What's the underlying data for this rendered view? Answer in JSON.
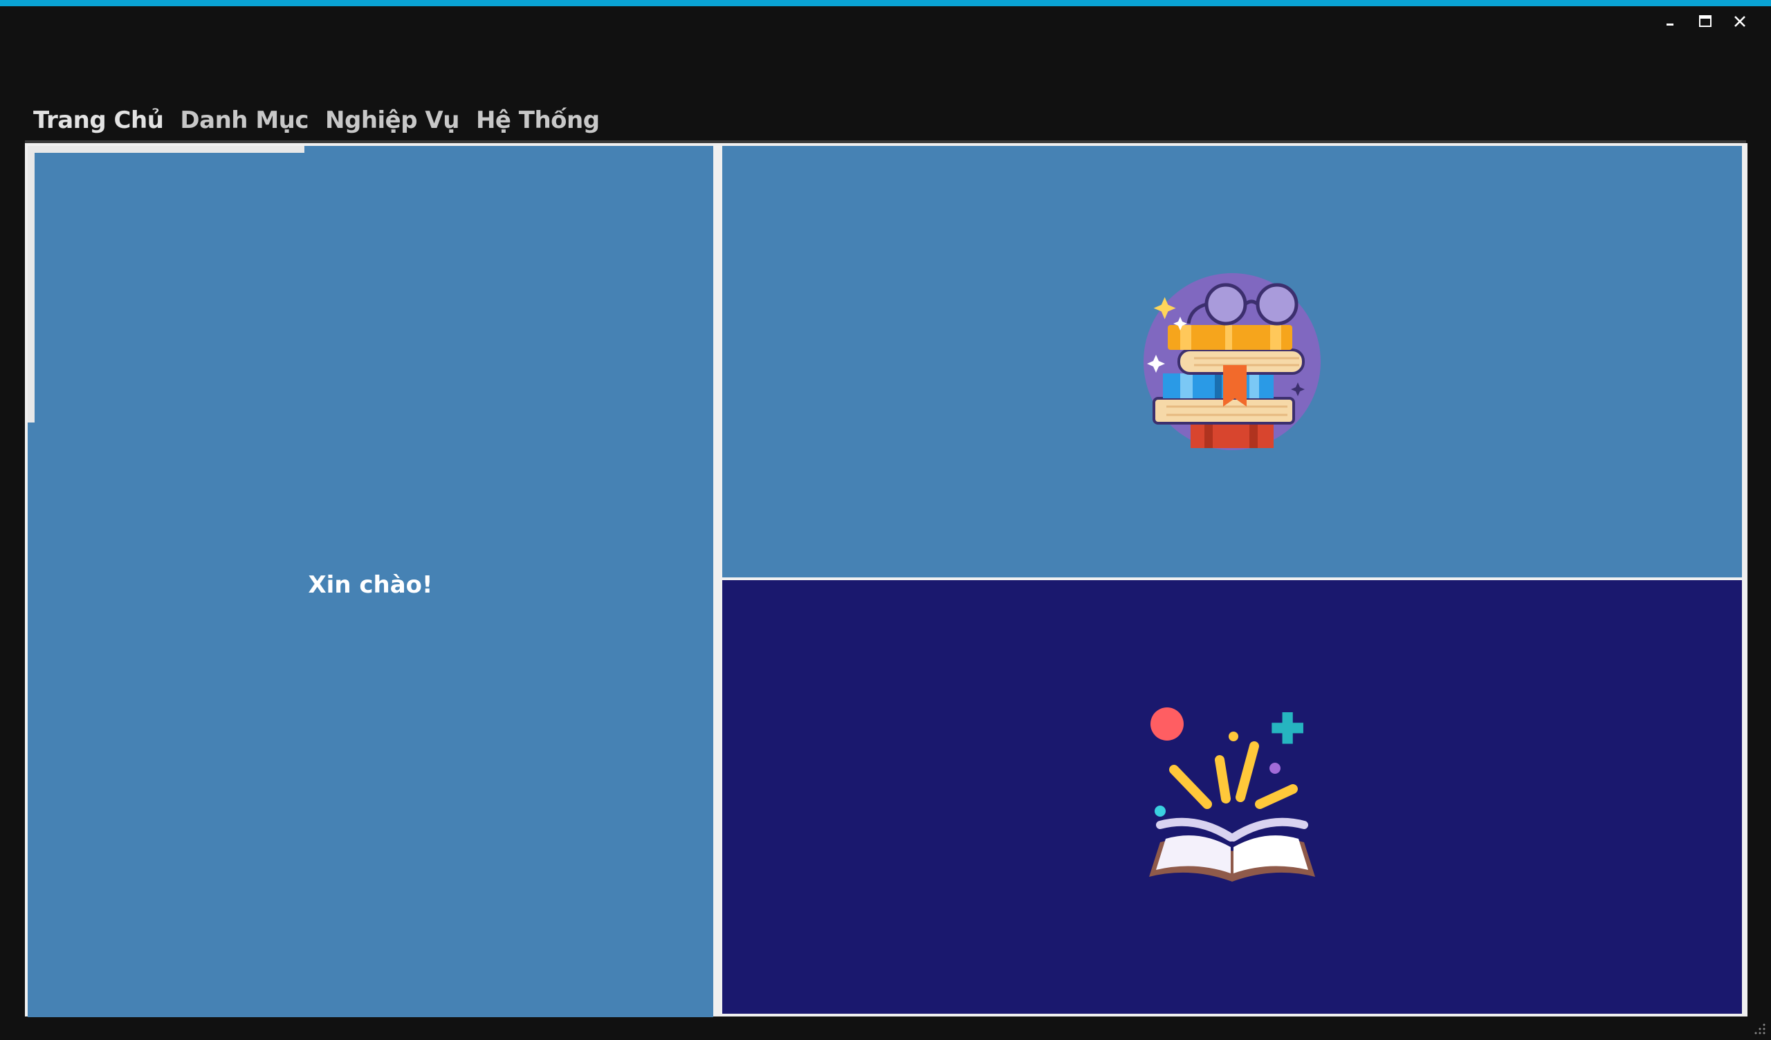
{
  "window": {
    "accent_color": "#0aa3d4",
    "controls": [
      {
        "name": "minimize",
        "icon": "minimize-icon"
      },
      {
        "name": "maximize",
        "icon": "maximize-icon"
      },
      {
        "name": "close",
        "icon": "close-icon"
      }
    ]
  },
  "tabs": [
    {
      "label": "Trang Chủ",
      "active": true
    },
    {
      "label": "Danh Mục",
      "active": false
    },
    {
      "label": "Nghiệp Vụ",
      "active": false
    },
    {
      "label": "Hệ Thống",
      "active": false
    }
  ],
  "home": {
    "greeting": "Xin chào!",
    "left_panel_color": "#4682b4",
    "top_right_panel_color": "#4682b4",
    "bottom_right_panel_color": "#1a186e",
    "top_image": "stacked-books-with-glasses-icon",
    "bottom_image": "open-book-sparkles-icon"
  }
}
